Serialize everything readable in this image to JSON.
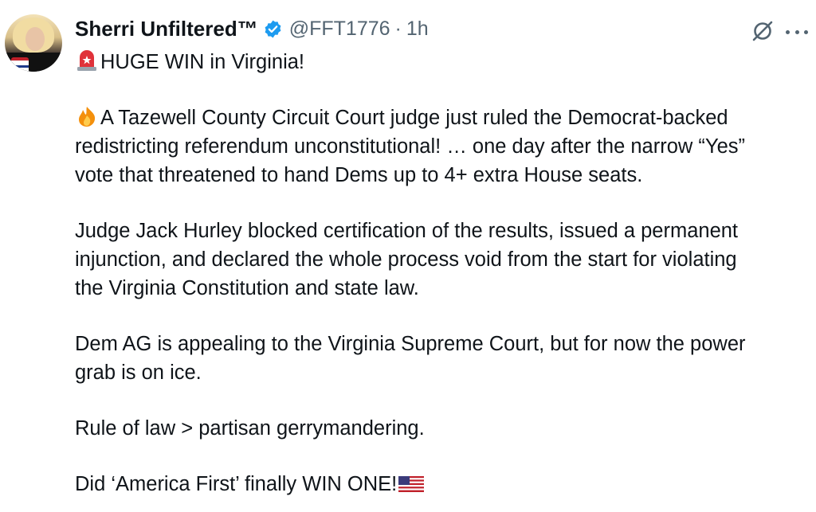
{
  "author": {
    "display_name": "Sherri Unfiltered™",
    "handle": "@FFT1776",
    "separator": "·",
    "time": "1h",
    "verified_color": "#1d9bf0"
  },
  "icons": {
    "verified": "verified-badge-icon",
    "grok": "grok-icon",
    "more": "more-options-icon",
    "siren": "police-light-emoji",
    "fire": "fire-emoji",
    "flag": "us-flag-emoji"
  },
  "tweet": {
    "headline": "HUGE WIN in Virginia!",
    "p1": [
      "A Tazewell County Circuit Court judge just ruled the Democrat-backed",
      "redistricting referendum unconstitutional! … one day after the narrow “Yes”",
      "vote that threatened to hand Dems up to 4+ extra House seats."
    ],
    "p2": [
      "Judge Jack Hurley blocked certification of the results, issued a permanent",
      "injunction, and declared the whole process void from the start for violating",
      "the Virginia Constitution and state law."
    ],
    "p3": [
      "Dem AG is appealing to the Virginia Supreme Court, but for now the power",
      "grab is on ice."
    ],
    "p4": "Rule of law > partisan gerrymandering.",
    "p5": "Did ‘America First’ finally WIN ONE!"
  },
  "colors": {
    "text": "#0f1419",
    "secondary": "#536471",
    "accent": "#1d9bf0"
  }
}
